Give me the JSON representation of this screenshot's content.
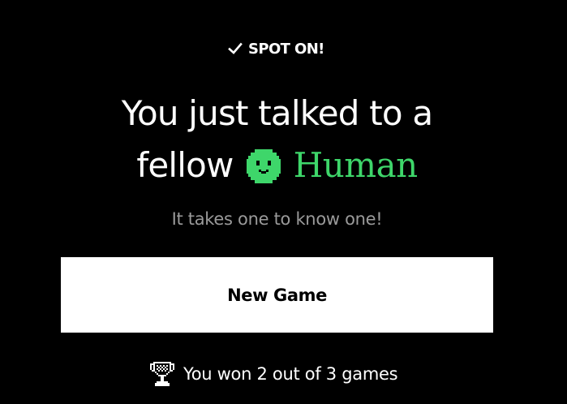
{
  "badge": {
    "icon": "check-icon",
    "label": "SPOT ON!"
  },
  "headline": {
    "line1": "You just talked to a",
    "line2_prefix": "fellow",
    "avatar_icon": "pixel-face-icon",
    "result_word": "Human"
  },
  "subtitle": "It takes one to know one!",
  "new_game_label": "New Game",
  "stats": {
    "icon": "trophy-icon",
    "text": "You won 2 out of 3 games"
  },
  "colors": {
    "background": "#000000",
    "accent_green": "#3ed66a",
    "muted_text": "#9a9a9a",
    "button_bg": "#ffffff"
  }
}
